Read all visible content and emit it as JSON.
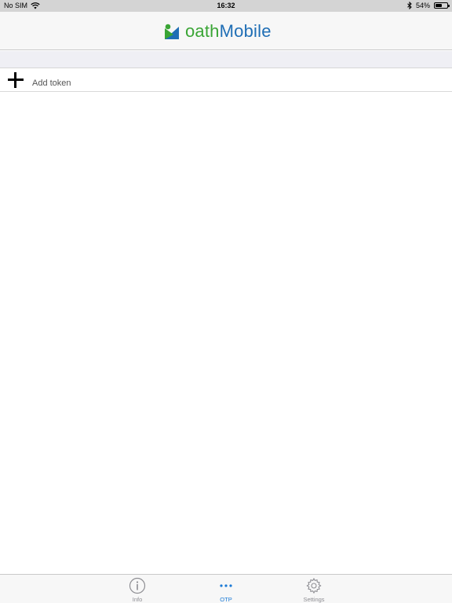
{
  "status_bar": {
    "carrier": "No SIM",
    "time": "16:32",
    "battery_percent": "54%",
    "battery_level": 0.54,
    "icons": [
      "wifi-icon",
      "bluetooth-icon",
      "battery-icon"
    ]
  },
  "header": {
    "brand_part1": "oath",
    "brand_part2": "Mobile",
    "logo_icon": "oathmobile-logo-icon",
    "colors": {
      "brand_green": "#3aa535",
      "brand_blue": "#1f6eb5"
    }
  },
  "list": {
    "add_token_label": "Add token",
    "add_icon": "plus-icon"
  },
  "tab_bar": {
    "active_color": "#1b7ad6",
    "inactive_color": "#8e8e93",
    "tabs": [
      {
        "label": "Info",
        "icon": "info-icon",
        "active": false
      },
      {
        "label": "OTP",
        "icon": "more-dots-icon",
        "active": true
      },
      {
        "label": "Settings",
        "icon": "gear-icon",
        "active": false
      }
    ]
  }
}
